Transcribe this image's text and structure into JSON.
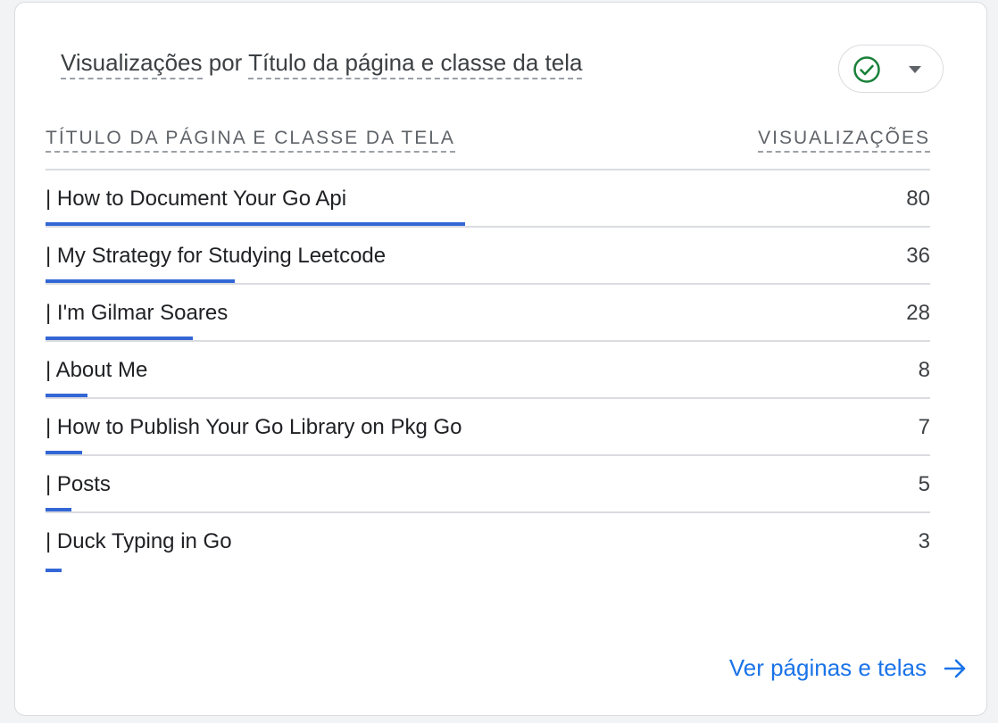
{
  "card": {
    "title_metric": "Visualizações",
    "title_connector": "por",
    "title_dimension": "Título da página e classe da tela",
    "status_icon": "check-circle-icon",
    "dropdown_icon": "caret-down-icon",
    "colors": {
      "accent": "#1a73e8",
      "bar": "#3367d6",
      "check": "#188038"
    }
  },
  "table": {
    "col_title": "TÍTULO DA PÁGINA E CLASSE DA TELA",
    "col_views": "VISUALIZAÇÕES",
    "max_value": 80,
    "rows": [
      {
        "label": "| How to Document Your Go Api",
        "value": 80,
        "value_text": "80"
      },
      {
        "label": "| My Strategy for Studying Leetcode",
        "value": 36,
        "value_text": "36"
      },
      {
        "label": "| I'm Gilmar Soares",
        "value": 28,
        "value_text": "28"
      },
      {
        "label": "| About Me",
        "value": 8,
        "value_text": "8"
      },
      {
        "label": "| How to Publish Your Go Library on Pkg Go",
        "value": 7,
        "value_text": "7"
      },
      {
        "label": "| Posts",
        "value": 5,
        "value_text": "5"
      },
      {
        "label": "| Duck Typing in Go",
        "value": 3,
        "value_text": "3"
      }
    ]
  },
  "footer": {
    "link_label": "Ver páginas e telas",
    "link_icon": "arrow-right-icon"
  }
}
